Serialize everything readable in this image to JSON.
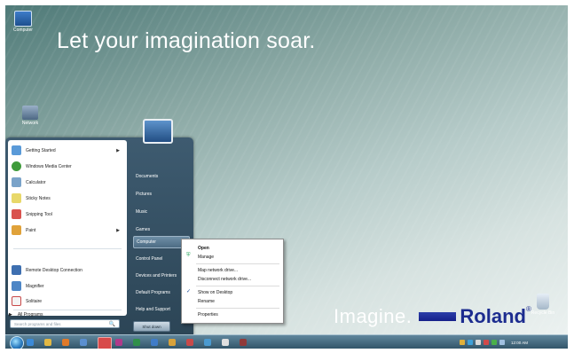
{
  "desktop": {
    "tagline": "Let your imagination soar.",
    "icons": [
      {
        "label": "Computer",
        "icon": "computer-icon"
      },
      {
        "label": "Network",
        "icon": "network-icon"
      },
      {
        "label": "Recycle Bin",
        "icon": "recycle-bin-icon"
      }
    ],
    "brand": {
      "imagine": "Imagine.",
      "name": "Roland",
      "reg": "®"
    }
  },
  "start_menu": {
    "programs": [
      {
        "label": "Getting Started",
        "icon": "getting-started-icon",
        "color": "#5a9ad8",
        "has_arrow": true
      },
      {
        "label": "Windows Media Center",
        "icon": "media-center-icon",
        "color": "#3f9b3b",
        "has_arrow": false
      },
      {
        "label": "Calculator",
        "icon": "calculator-icon",
        "color": "#7aa3c9",
        "has_arrow": false
      },
      {
        "label": "Sticky Notes",
        "icon": "sticky-notes-icon",
        "color": "#e8d86a",
        "has_arrow": false
      },
      {
        "label": "Snipping Tool",
        "icon": "snipping-tool-icon",
        "color": "#d9534f",
        "has_arrow": false
      },
      {
        "label": "Paint",
        "icon": "paint-icon",
        "color": "#e0a23a",
        "has_arrow": true
      },
      {
        "label": "Remote Desktop Connection",
        "icon": "remote-desktop-icon",
        "color": "#3e6fb0",
        "has_arrow": false
      },
      {
        "label": "Magnifier",
        "icon": "magnifier-icon",
        "color": "#4d86c6",
        "has_arrow": false
      },
      {
        "label": "Solitaire",
        "icon": "solitaire-icon",
        "color": "#c94a4a",
        "has_arrow": false
      }
    ],
    "arrow": "▶",
    "all_programs": "All Programs",
    "all_programs_arrow": "▶",
    "search_placeholder": "Search programs and files",
    "search_icon": "🔍",
    "right_items": [
      "Documents",
      "Pictures",
      "Music",
      "Games",
      "Computer",
      "Control Panel",
      "Devices and Printers",
      "Default Programs",
      "Help and Support"
    ],
    "active_right_item": "Computer",
    "shutdown_label": "Shut down"
  },
  "context_menu": {
    "items": [
      {
        "label": "Open",
        "bold": true
      },
      {
        "label": "Manage",
        "bold": false,
        "icon": "manage-shield-icon"
      },
      {
        "label": "Map network drive...",
        "bold": false
      },
      {
        "label": "Disconnect network drive...",
        "bold": false
      },
      {
        "label": "Show on Desktop",
        "bold": false,
        "checked": true
      },
      {
        "label": "Rename",
        "bold": false
      },
      {
        "label": "Properties",
        "bold": false
      }
    ],
    "check_glyph": "✓",
    "manage_glyph": "⛨"
  },
  "taskbar": {
    "pinned_icons": [
      {
        "name": "ie-icon",
        "color": "#3b8ad8"
      },
      {
        "name": "explorer-icon",
        "color": "#e2b844"
      },
      {
        "name": "media-player-icon",
        "color": "#e07a2a"
      },
      {
        "name": "app-icon-1",
        "color": "#5a8fd0"
      },
      {
        "name": "app-icon-2",
        "color": "#d84a4a"
      },
      {
        "name": "app-icon-3",
        "color": "#b03a8a"
      },
      {
        "name": "app-icon-4",
        "color": "#2f8f4a"
      },
      {
        "name": "app-icon-5",
        "color": "#3f7cc8"
      },
      {
        "name": "app-icon-6",
        "color": "#d8a23a"
      },
      {
        "name": "app-icon-7",
        "color": "#c84a4a"
      },
      {
        "name": "app-icon-8",
        "color": "#4a9ad0"
      },
      {
        "name": "app-icon-9",
        "color": "#e0e0e0"
      },
      {
        "name": "app-icon-10",
        "color": "#8f3a3a"
      }
    ],
    "tray_colors": [
      "#e0b03a",
      "#3fa0d8",
      "#d8d8d8",
      "#d04a4a",
      "#4ab04a",
      "#a0c0e0"
    ],
    "clock": "12:00 AM"
  }
}
